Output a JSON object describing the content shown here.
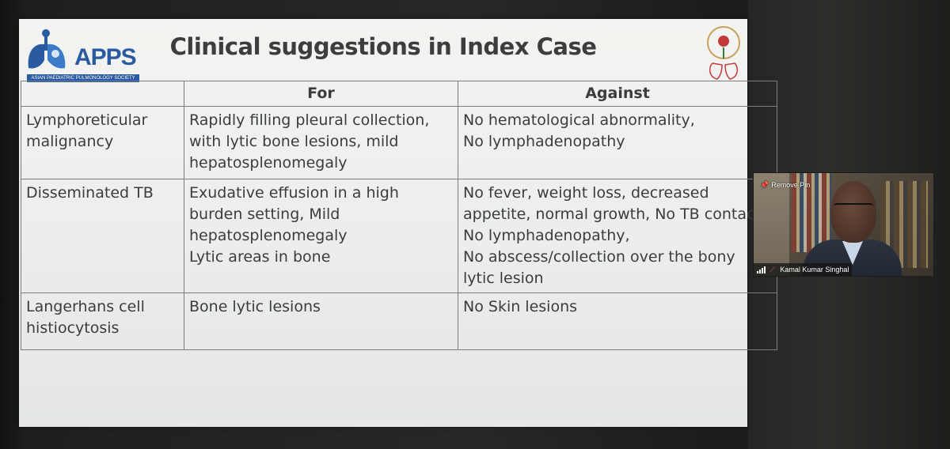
{
  "slide": {
    "title": "Clinical suggestions in Index Case",
    "logo_left_text": "APPS",
    "logo_left_subtitle": "ASIAN PAEDIATRIC PULMONOLOGY SOCIETY",
    "logo_right_text": "INDIAN ACADEMY OF PEDIATRICS",
    "table": {
      "headers": [
        "",
        "For",
        "Against"
      ],
      "rows": [
        {
          "condition": [
            "Lymphoreticular",
            "malignancy"
          ],
          "for": [
            "Rapidly filling  pleural collection,",
            "with lytic bone lesions, mild",
            "hepatosplenomegaly"
          ],
          "against": [
            "No hematological abnormality,",
            "No lymphadenopathy"
          ]
        },
        {
          "condition": [
            "Disseminated TB"
          ],
          "for": [
            "Exudative effusion in a high",
            "burden setting, Mild",
            "hepatosplenomegaly",
            "Lytic areas in bone"
          ],
          "against": [
            "No fever, weight loss, decreased",
            "appetite, normal growth, No TB contact,",
            "No lymphadenopathy,",
            "No abscess/collection over the bony",
            "lytic lesion"
          ]
        },
        {
          "condition": [
            "Langerhans cell",
            "histiocytosis"
          ],
          "for": [
            "Bone lytic lesions"
          ],
          "against": [
            "No Skin lesions"
          ]
        }
      ]
    }
  },
  "video_tile": {
    "pin_label": "Remove Pin",
    "pin_icon": "pin-icon",
    "participant_name": "Kamal Kumar Singhal",
    "signal_icon": "signal-bars-icon",
    "mic_icon": "mic-muted-icon",
    "mic_color": "#e0443b"
  }
}
